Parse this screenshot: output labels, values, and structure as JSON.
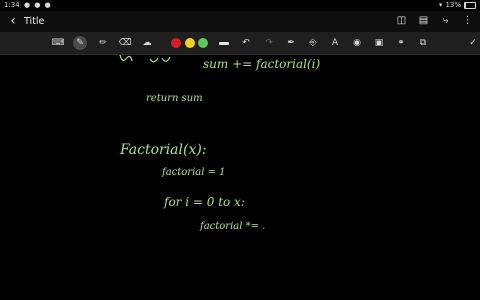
{
  "status_bar": {
    "time": "1:34",
    "dots": "● ● ●",
    "battery": "13%"
  },
  "header": {
    "title": "Title",
    "icons": [
      "back-arrow-icon",
      "book-icon",
      "document-icon",
      "attach-icon",
      "more-icon"
    ]
  },
  "toolbar": {
    "tools": [
      "keyboard-icon",
      "pen-icon",
      "highlighter-icon",
      "eraser-icon",
      "lasso-icon"
    ],
    "pen_colors": [
      "#d62020",
      "#f2d21f",
      "#5cc95a"
    ],
    "actions": [
      "undo-icon",
      "redo-icon",
      "shape-pen-icon",
      "text-style-icon",
      "text-icon",
      "fill-icon",
      "image-icon",
      "link-icon",
      "copy-icon",
      "pen-tool-icon"
    ]
  },
  "ink_color": "#aee28a",
  "note": {
    "lines": [
      "sum += factorial(i)",
      "return sum",
      "Factorial(x):",
      "factorial = 1",
      "for i = 0 to x:",
      "factorial *= ."
    ]
  }
}
